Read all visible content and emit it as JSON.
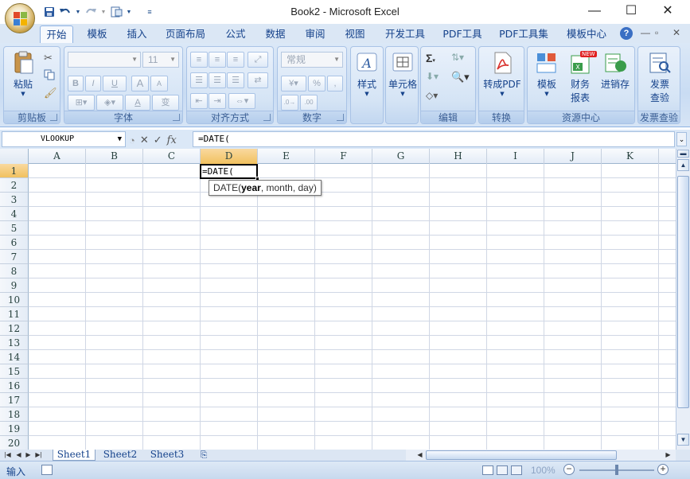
{
  "window": {
    "title": "Book2 - Microsoft Excel"
  },
  "quick_access": {
    "icons": [
      "save-icon",
      "undo-icon",
      "redo-icon",
      "print-preview-icon",
      "customize-icon"
    ]
  },
  "tabs": [
    "开始",
    "模板",
    "插入",
    "页面布局",
    "公式",
    "数据",
    "审阅",
    "视图",
    "开发工具",
    "PDF工具",
    "PDF工具集",
    "模板中心"
  ],
  "ribbon": {
    "clipboard": {
      "paste": "粘贴",
      "label": "剪贴板"
    },
    "font": {
      "font_size": "11",
      "bold": "B",
      "italic": "I",
      "underline": "U",
      "grow": "A",
      "shrink": "A",
      "fontcolor": "A",
      "phonetic": "变",
      "label": "字体"
    },
    "alignment": {
      "label": "对齐方式"
    },
    "number": {
      "format": "常规",
      "percent": "%",
      "comma": ",",
      "label": "数字"
    },
    "styles": {
      "label": "样式"
    },
    "cells": {
      "label": "单元格"
    },
    "editing": {
      "sum": "Σ",
      "label": "编辑"
    },
    "convert": {
      "button": "转成PDF",
      "label": "转换"
    },
    "resource": {
      "template": "模板",
      "finance": "财务",
      "finance2": "报表",
      "invoice": "进销存",
      "new_badge": "NEW",
      "label": "资源中心"
    },
    "invoice_check": {
      "button1": "发票",
      "button2": "查验",
      "label": "发票查验"
    }
  },
  "formula_bar": {
    "name_box": "VLOOKUP",
    "fx": "fx",
    "formula": "=DATE("
  },
  "grid": {
    "columns": [
      "A",
      "B",
      "C",
      "D",
      "E",
      "F",
      "G",
      "H",
      "I",
      "J",
      "K"
    ],
    "rows": [
      "1",
      "2",
      "3",
      "4",
      "5",
      "6",
      "7",
      "8",
      "9",
      "10",
      "11",
      "12",
      "13",
      "14",
      "15",
      "16",
      "17",
      "18",
      "19",
      "20"
    ],
    "active_cell_text": "=DATE(",
    "tooltip": {
      "func": "DATE(",
      "arg1": "year",
      "rest": ", month, day)"
    }
  },
  "sheets": [
    "Sheet1",
    "Sheet2",
    "Sheet3"
  ],
  "status": {
    "mode": "输入",
    "zoom": "100%"
  }
}
